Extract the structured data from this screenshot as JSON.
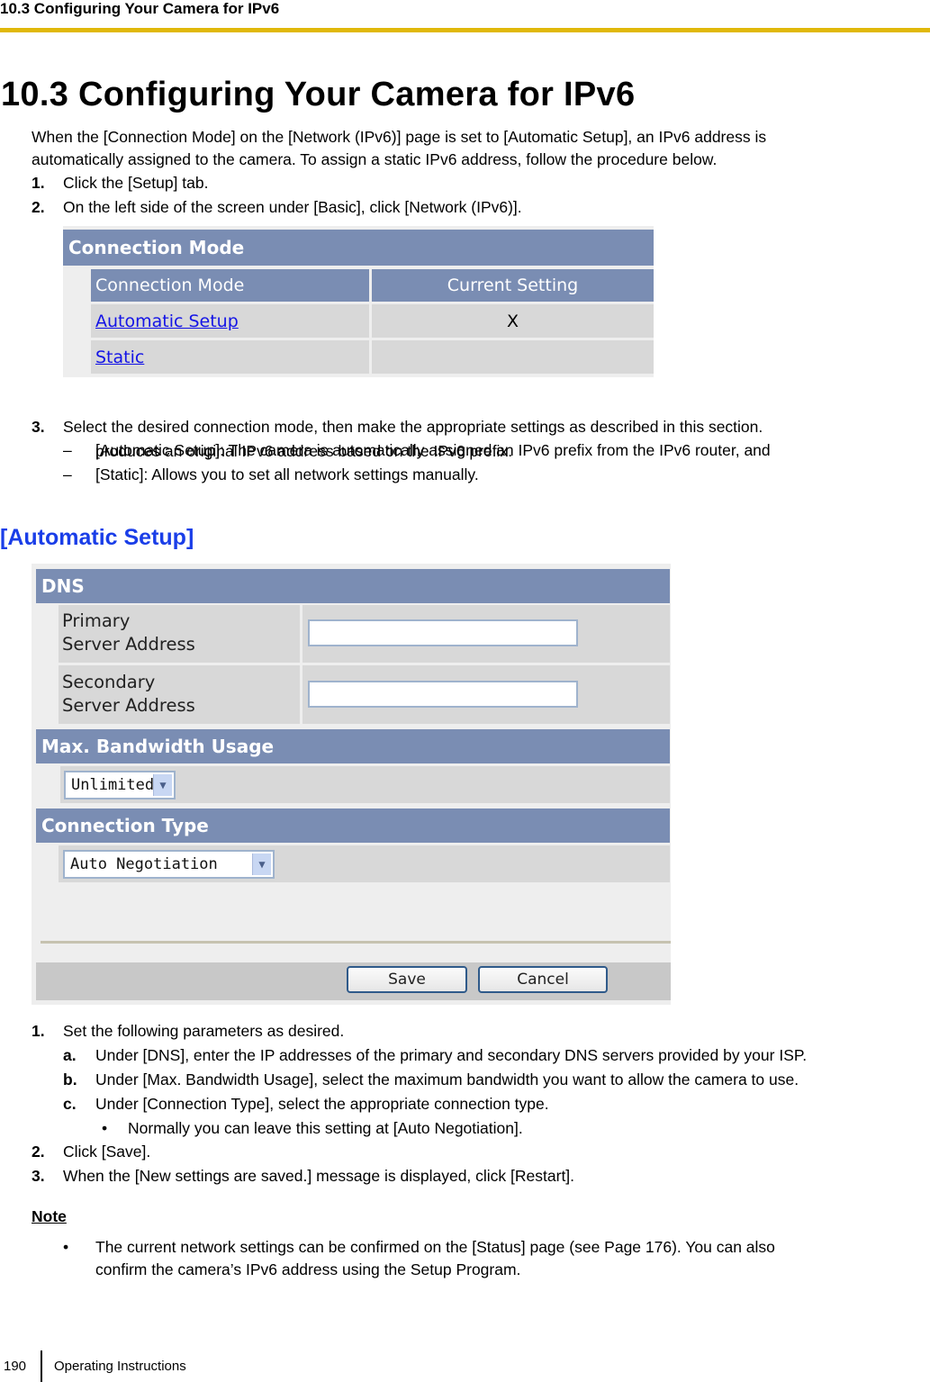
{
  "running_head": "10.3 Configuring Your Camera for IPv6",
  "title": "10.3  Configuring Your Camera for IPv6",
  "intro": [
    "When the [Connection Mode] on the [Network (IPv6)] page is set to [Automatic Setup], an IPv6 address is",
    "automatically assigned to the camera. To assign a static IPv6 address, follow the procedure below."
  ],
  "steps_top": [
    {
      "num": "1.",
      "text": "Click the [Setup] tab."
    },
    {
      "num": "2.",
      "text": "On the left side of the screen under [Basic], click [Network (IPv6)]."
    }
  ],
  "connection_mode_ui": {
    "section_title": "Connection Mode",
    "columns": [
      "Connection Mode",
      "Current Setting"
    ],
    "rows": [
      {
        "mode": "Automatic Setup",
        "current": "X"
      },
      {
        "mode": "Static",
        "current": ""
      }
    ]
  },
  "step3": {
    "num": "3.",
    "text": "Select the desired connection mode, then make the appropriate settings as described in this section.",
    "dashes": [
      {
        "mark": "–",
        "lines": [
          "[Automatic Setup]: The camera is automatically assigned an IPv6 prefix from the IPv6 router, and",
          "produces an original IPv6 address based on the IPv6 prefix."
        ]
      },
      {
        "mark": "–",
        "lines": [
          "[Static]: Allows you to set all network settings manually."
        ]
      }
    ]
  },
  "subheading": "[Automatic Setup]",
  "auto_setup_ui": {
    "dns": {
      "title": "DNS",
      "primary_label": [
        "Primary",
        "Server Address"
      ],
      "primary_value": "",
      "secondary_label": [
        "Secondary",
        "Server Address"
      ],
      "secondary_value": ""
    },
    "bandwidth": {
      "title": "Max. Bandwidth Usage",
      "selected": "Unlimited"
    },
    "connection_type": {
      "title": "Connection Type",
      "selected": "Auto Negotiation"
    },
    "buttons": {
      "save": "Save",
      "cancel": "Cancel"
    }
  },
  "steps_bottom": [
    {
      "num": "1.",
      "text": "Set the following parameters as desired."
    },
    {
      "num": "a.",
      "text": "Under [DNS], enter the IP addresses of the primary and secondary DNS servers provided by your ISP."
    },
    {
      "num": "b.",
      "text": "Under [Max. Bandwidth Usage], select the maximum bandwidth you want to allow the camera to use."
    },
    {
      "num": "c.",
      "text": "Under [Connection Type], select the appropriate connection type."
    },
    {
      "num": "•",
      "text": "Normally you can leave this setting at [Auto Negotiation]."
    },
    {
      "num": "2.",
      "text": "Click [Save]."
    },
    {
      "num": "3.",
      "text": "When the [New settings are saved.] message is displayed, click [Restart]."
    }
  ],
  "note": {
    "heading": "Note",
    "bullet": "•",
    "lines": [
      "The current network settings can be confirmed on the [Status] page (see Page 176). You can also",
      "confirm the camera’s IPv6 address using the Setup Program."
    ]
  },
  "footer": {
    "page": "190",
    "label": "Operating Instructions"
  }
}
